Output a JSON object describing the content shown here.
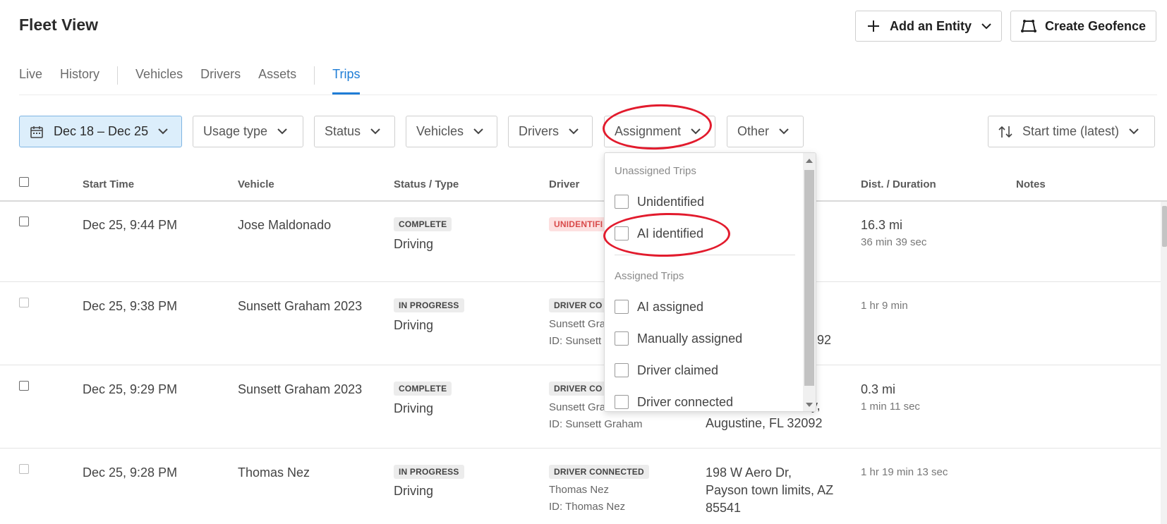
{
  "app": {
    "title": "Fleet View"
  },
  "header_actions": {
    "add_entity": "Add an Entity",
    "create_geofence": "Create Geofence"
  },
  "tabs": [
    {
      "label": "Live"
    },
    {
      "label": "History"
    },
    {
      "label": "Vehicles"
    },
    {
      "label": "Drivers"
    },
    {
      "label": "Assets"
    },
    {
      "label": "Trips",
      "active": true
    }
  ],
  "filters": {
    "date_range": "Dec 18 – Dec 25",
    "usage_type": "Usage type",
    "status": "Status",
    "vehicles": "Vehicles",
    "drivers": "Drivers",
    "assignment": "Assignment",
    "other": "Other",
    "sort": "Start time (latest)"
  },
  "table": {
    "columns": {
      "start_time": "Start Time",
      "vehicle": "Vehicle",
      "status_type": "Status / Type",
      "driver": "Driver",
      "dist_duration": "Dist. / Duration",
      "notes": "Notes"
    },
    "rows": [
      {
        "start_time": "Dec 25, 9:44 PM",
        "vehicle": "Jose Maldonado",
        "status": "COMPLETE",
        "type": "Driving",
        "driver_badge": "UNIDENTIFI",
        "distance": "16.3 mi",
        "duration": "36 min 39 sec"
      },
      {
        "start_time": "Dec 25, 9:38 PM",
        "vehicle": "Sunsett Graham 2023",
        "status": "IN PROGRESS",
        "type": "Driving",
        "driver_badge": "DRIVER CO",
        "driver_name": "Sunsett Gra",
        "driver_id": "ID: Sunsett",
        "location": "92",
        "duration": "1 hr 9 min"
      },
      {
        "start_time": "Dec 25, 9:29 PM",
        "vehicle": "Sunsett Graham 2023",
        "status": "COMPLETE",
        "type": "Driving",
        "driver_badge": "DRIVER CO",
        "driver_name": "Sunsett Gra",
        "driver_id": "ID: Sunsett Graham",
        "location_line1": "y,",
        "location_line2": "Augustine, FL 32092",
        "distance": "0.3 mi",
        "duration": "1 min 11 sec"
      },
      {
        "start_time": "Dec 25, 9:28 PM",
        "vehicle": "Thomas Nez",
        "status": "IN PROGRESS",
        "type": "Driving",
        "driver_badge": "DRIVER CONNECTED",
        "driver_name": "Thomas Nez",
        "driver_id": "ID: Thomas Nez",
        "location_line1": "198 W Aero Dr,",
        "location_line2": "Payson town limits, AZ",
        "location_line3": "85541",
        "duration": "1 hr 19 min 13 sec"
      }
    ]
  },
  "assignment_dropdown": {
    "group_unassigned": "Unassigned Trips",
    "unassigned_options": [
      "Unidentified",
      "AI identified"
    ],
    "group_assigned": "Assigned Trips",
    "assigned_options": [
      "AI assigned",
      "Manually assigned",
      "Driver claimed",
      "Driver connected"
    ]
  },
  "colors": {
    "accent": "#1f7dd6",
    "date_filter_bg": "#dceefb",
    "annotation": "#e21b2d",
    "unidentified_badge": "#fde0e0"
  },
  "icons": {
    "add": "plus-icon",
    "geofence": "geofence-icon",
    "date": "calendar-icon",
    "sort": "sort-icon",
    "dropdown": "chevron-down-icon"
  }
}
